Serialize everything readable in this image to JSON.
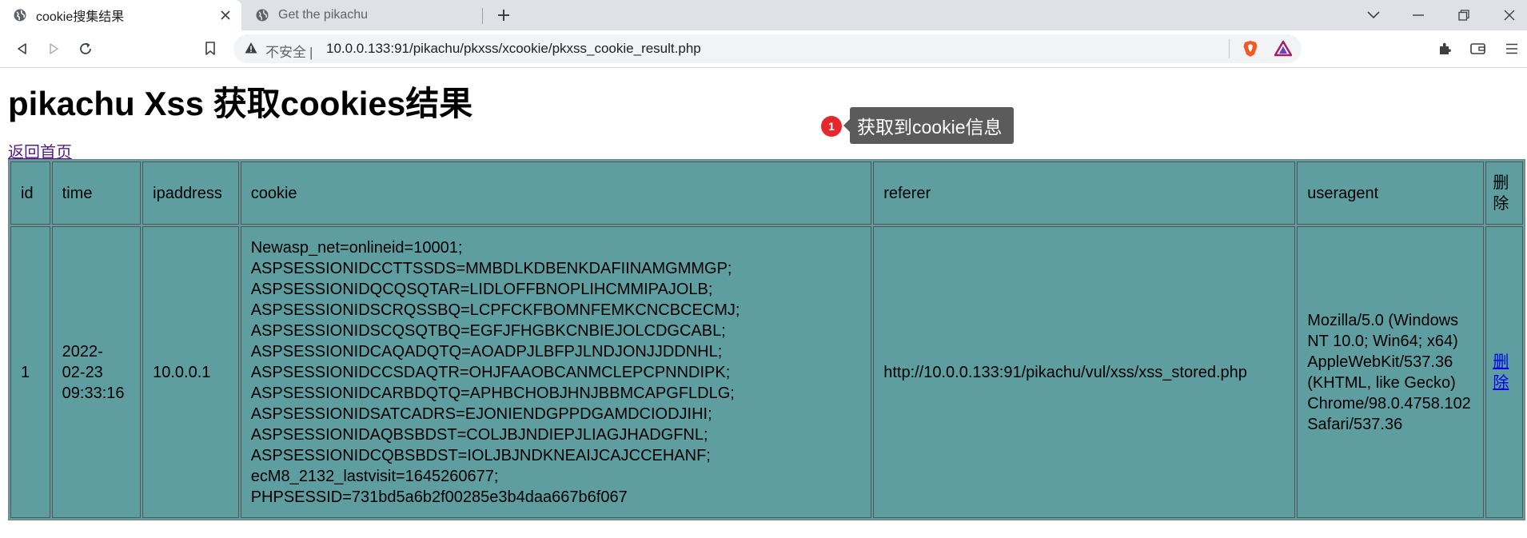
{
  "tabs": [
    {
      "title": "cookie搜集结果",
      "active": true
    },
    {
      "title": "Get the pikachu",
      "active": false
    }
  ],
  "address_bar": {
    "security_label": "不安全",
    "separator": "|",
    "url": "10.0.0.133:91/pikachu/pkxss/xcookie/pkxss_cookie_result.php"
  },
  "page": {
    "heading": "pikachu Xss 获取cookies结果",
    "back_link": "返回首页"
  },
  "annotation": {
    "number": "1",
    "text": "获取到cookie信息"
  },
  "table": {
    "headers": [
      "id",
      "time",
      "ipaddress",
      "cookie",
      "referer",
      "useragent",
      "删除"
    ],
    "rows": [
      {
        "id": "1",
        "time_lines": [
          "2022-",
          "02-23",
          "09:33:16"
        ],
        "ipaddress": "10.0.0.1",
        "cookie_lines": [
          "Newasp_net=onlineid=10001;",
          "ASPSESSIONIDCCTTSSDS=MMBDLKDBENKDAFIINAMGMMGP;",
          "ASPSESSIONIDQCQSQTAR=LIDLOFFBNOPLIHCMMIPAJOLB;",
          "ASPSESSIONIDSCRQSSBQ=LCPFCKFBOMNFEMKCNCBCECMJ;",
          "ASPSESSIONIDSCQSQTBQ=EGFJFHGBKCNBIEJOLCDGCABL;",
          "ASPSESSIONIDCAQADQTQ=AOADPJLBFPJLNDJONJJDDNHL;",
          "ASPSESSIONIDCCSDAQTR=OHJFAAOBCANMCLEPCPNNDIPK;",
          "ASPSESSIONIDCARBDQTQ=APHBCHOBJHNJBBMCAPGFLDLG;",
          "ASPSESSIONIDSATCADRS=EJONIENDGPPDGAMDCIODJIHI;",
          "ASPSESSIONIDAQBSBDST=COLJBJNDIEPJLIAGJHADGFNL;",
          "ASPSESSIONIDCQBSBDST=IOLJBJNDKNEAIJCAJCCEHANF;",
          "ecM8_2132_lastvisit=1645260677;",
          "PHPSESSID=731bd5a6b2f00285e3b4daa667b6f067"
        ],
        "referer": "http://10.0.0.133:91/pikachu/vul/xss/xss_stored.php",
        "useragent_lines": [
          "Mozilla/5.0 (Windows",
          "NT 10.0; Win64; x64)",
          "AppleWebKit/537.36",
          "(KHTML, like Gecko)",
          "Chrome/98.0.4758.102",
          "Safari/537.36"
        ],
        "delete_lines": [
          "删",
          "除"
        ]
      }
    ]
  },
  "colors": {
    "table_bg": "#5f9ea0",
    "badge": "#e8272c",
    "tooltip_bg": "#5b5b5b"
  },
  "icons": [
    "globe-icon",
    "close-icon",
    "plus-icon",
    "chevron-down-icon",
    "minimize-icon",
    "restore-icon",
    "window-close-icon",
    "back-icon",
    "forward-icon",
    "reload-icon",
    "bookmark-icon",
    "warning-icon",
    "brave-shield-icon",
    "brave-rewards-icon",
    "extensions-icon",
    "wallet-icon",
    "menu-icon"
  ]
}
